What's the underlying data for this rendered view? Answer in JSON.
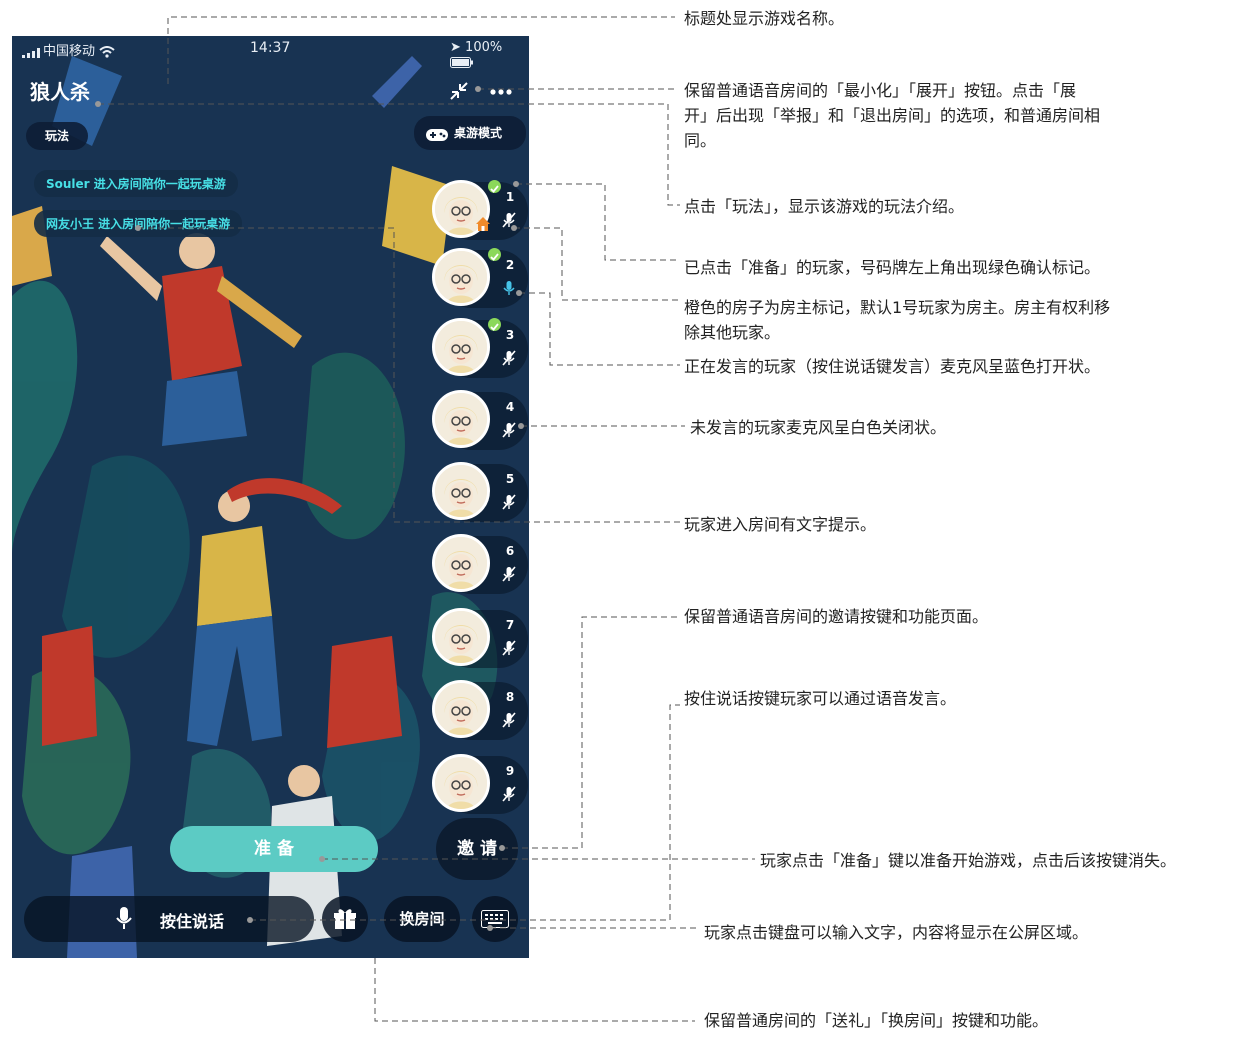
{
  "status_bar": {
    "carrier": "中国移动",
    "time": "14:37",
    "battery": "100%"
  },
  "header": {
    "title": "狼人杀"
  },
  "buttons": {
    "rules": "玩法",
    "board_mode": "桌游模式",
    "ready": "准 备",
    "invite": "邀 请",
    "push_to_talk": "按住说话",
    "change_room": "换房间"
  },
  "notices": [
    "Souler 进入房间陪你一起玩桌游",
    "网友小王 进入房间陪你一起玩桌游"
  ],
  "seats": [
    {
      "number": "1",
      "ready": true,
      "host": true,
      "mic": "muted"
    },
    {
      "number": "2",
      "ready": true,
      "host": false,
      "mic": "speaking"
    },
    {
      "number": "3",
      "ready": true,
      "host": false,
      "mic": "muted"
    },
    {
      "number": "4",
      "ready": false,
      "host": false,
      "mic": "muted"
    },
    {
      "number": "5",
      "ready": false,
      "host": false,
      "mic": "muted"
    },
    {
      "number": "6",
      "ready": false,
      "host": false,
      "mic": "muted"
    },
    {
      "number": "7",
      "ready": false,
      "host": false,
      "mic": "muted"
    },
    {
      "number": "8",
      "ready": false,
      "host": false,
      "mic": "muted"
    },
    {
      "number": "9",
      "ready": false,
      "host": false,
      "mic": "muted"
    }
  ],
  "colors": {
    "ready_button": "#5ccbc4",
    "ready_check": "#8bd85a",
    "speaking_mic": "#47c4e8",
    "notice_text": "#47e0e6",
    "host_badge": "#f08a2a"
  },
  "annotations": {
    "title": "标题处显示游戏名称。",
    "minimize_1": "保留普通语音房间的「最小化」「展开」按钮。点击「展",
    "minimize_2": "开」后出现「举报」和「退出房间」的选项，和普通房间相",
    "minimize_3": "同。",
    "rules": "点击「玩法」，显示该游戏的玩法介绍。",
    "ready_mark": "已点击「准备」的玩家，号码牌左上角出现绿色确认标记。",
    "host_1": "橙色的房子为房主标记，默认1号玩家为房主。房主有权利移",
    "host_2": "除其他玩家。",
    "speaking": "正在发言的玩家（按住说话键发言）麦克风呈蓝色打开状。",
    "muted": "未发言的玩家麦克风呈白色关闭状。",
    "enter": "玩家进入房间有文字提示。",
    "invite": "保留普通语音房间的邀请按键和功能页面。",
    "talk": "按住说话按键玩家可以通过语音发言。",
    "ready_btn": "玩家点击「准备」键以准备开始游戏，点击后该按键消失。",
    "keyboard": "玩家点击键盘可以输入文字，内容将显示在公屏区域。",
    "gift": "保留普通房间的「送礼」「换房间」按键和功能。"
  }
}
